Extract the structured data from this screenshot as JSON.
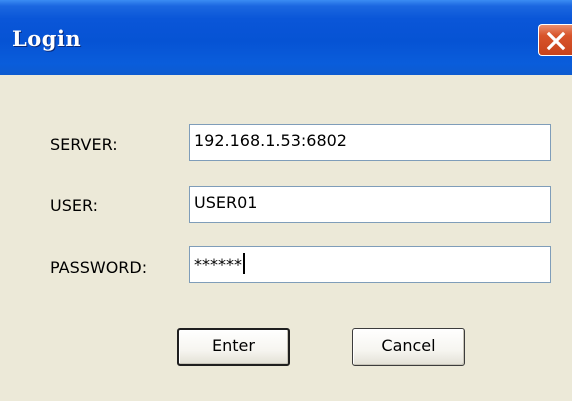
{
  "window": {
    "title": "Login",
    "close_icon": "close-icon"
  },
  "form": {
    "server_label": "SERVER:",
    "server_value": "192.168.1.53:6802",
    "user_label": "USER:",
    "user_value": "USER01",
    "password_label": "PASSWORD:",
    "password_value": "******"
  },
  "buttons": {
    "enter_label": "Enter",
    "cancel_label": "Cancel"
  },
  "colors": {
    "titlebar": "#0653d4",
    "close_button": "#d8542b",
    "window_background": "#ece9d8",
    "field_border": "#7f9db9"
  }
}
